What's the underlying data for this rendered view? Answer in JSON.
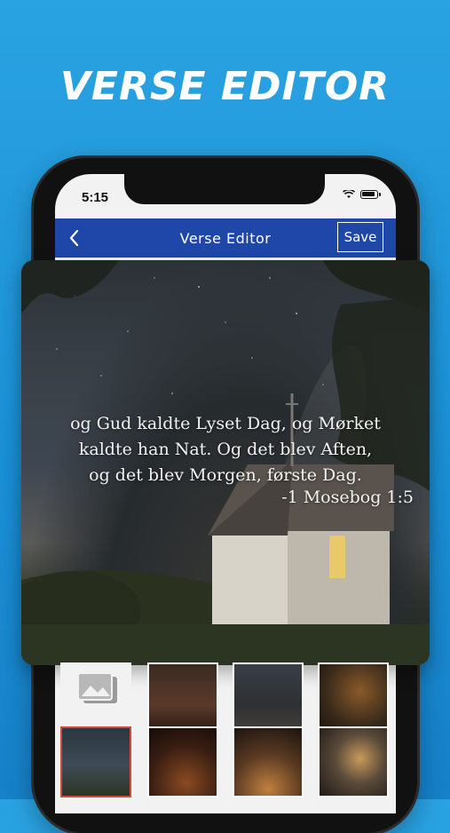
{
  "promo": {
    "title": "VERSE EDITOR"
  },
  "status_bar": {
    "time": "5:15"
  },
  "navbar": {
    "title": "Verse  Editor",
    "save_label": "Save"
  },
  "preview": {
    "verse_lines": [
      "og Gud kaldte Lyset Dag, og Mørket",
      "kaldte han Nat. Og det blev Aften,",
      "og det blev Morgen, første Dag."
    ],
    "reference": "-1 Mosebog 1:5"
  },
  "thumbnails": [
    {
      "name": "gallery-picker"
    },
    {
      "name": "bg-thumb-candles"
    },
    {
      "name": "bg-thumb-road"
    },
    {
      "name": "bg-thumb-lights"
    },
    {
      "name": "bg-thumb-church",
      "selected": true
    },
    {
      "name": "bg-thumb-cross-person"
    },
    {
      "name": "bg-thumb-cross-sunset"
    },
    {
      "name": "bg-thumb-cross-dark"
    }
  ],
  "colors": {
    "background": "#1b90d6",
    "navbar": "#1e47a8",
    "selected_border": "#d8473b"
  }
}
